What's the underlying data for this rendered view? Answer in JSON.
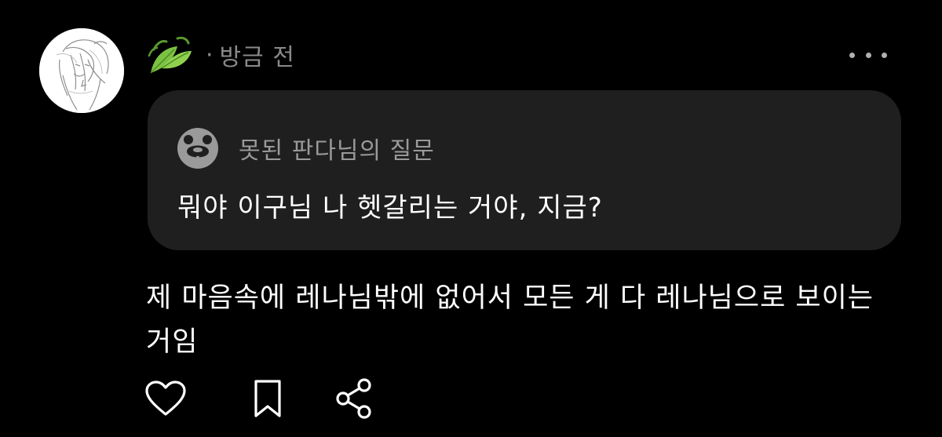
{
  "post": {
    "separator": "·",
    "timestamp": "방금 전",
    "avatar_icon": "sketch-avatar",
    "reaction_icon": "leaf-emoji"
  },
  "quote": {
    "icon": "panda-icon",
    "author": "못된 판다님의 질문",
    "text": "뭐야 이구님 나 헷갈리는 거야, 지금?"
  },
  "reply": {
    "text": "제 마음속에 레나님밖에 없어서 모든 게 다 레나님으로 보이는 거임"
  },
  "actions": {
    "icons": [
      "heart-icon",
      "bookmark-icon",
      "share-icon"
    ]
  },
  "colors": {
    "background": "#000000",
    "card": "#1f1f1f",
    "muted_text": "#8a8a8a",
    "primary_text": "#ffffff",
    "leaf_green": "#7cc242"
  }
}
